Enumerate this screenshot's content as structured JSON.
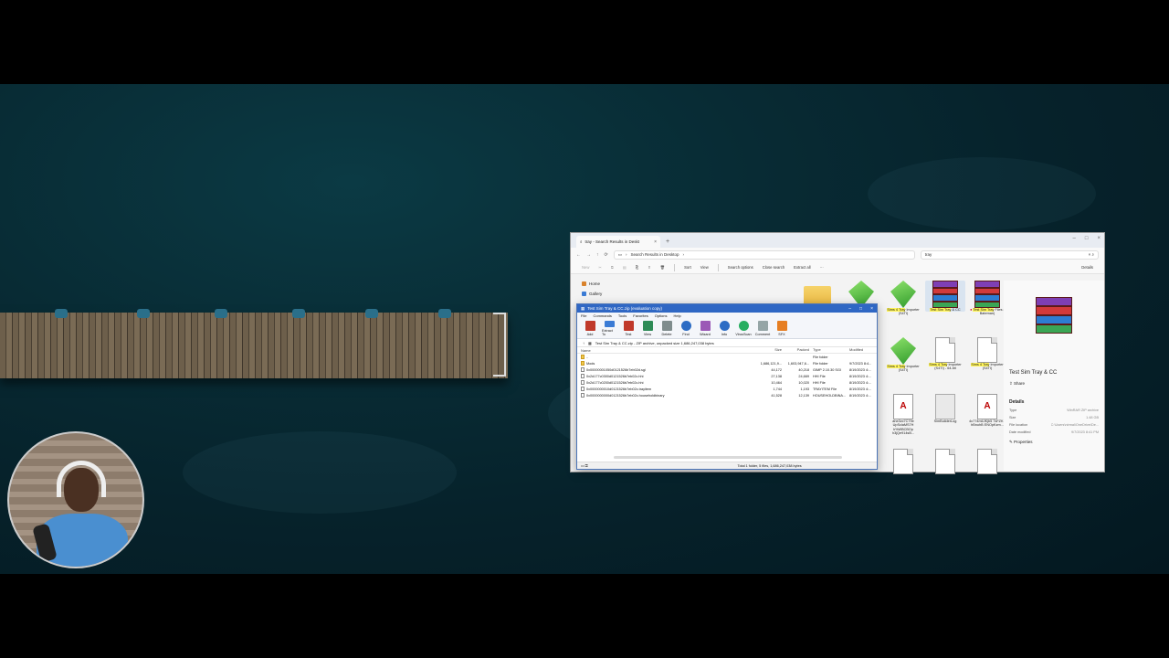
{
  "explorer": {
    "tab_title": "tray - Search Results in Deskt",
    "address": "Search Results in Desktop",
    "search_value": "tray",
    "cmd": {
      "new": "New",
      "sort": "Sort",
      "view": "View",
      "search_options": "Search options",
      "close_search": "Close search",
      "extract_all": "Extract all",
      "more": "···",
      "details": "Details"
    },
    "nav": [
      {
        "label": "Home"
      },
      {
        "label": "Gallery"
      }
    ],
    "tiles": [
      {
        "label": "",
        "kind": "folder"
      },
      {
        "label": "",
        "kind": "sims"
      },
      {
        "label": "Importer (S4TI)",
        "kind": "sims",
        "hl": "Sims 4 Tray"
      },
      {
        "label": "& CC",
        "kind": "rar",
        "hl": "Test Sim Tray",
        "selected": true
      },
      {
        "label": "Files ( Bateman)",
        "kind": "rar",
        "hl": "Test Sim Tray"
      },
      {
        "label": "Importer (S4TI)",
        "kind": "sims",
        "hl": "Sims 4 Tray"
      },
      {
        "label": "Importer (S4TI) - 64-bit",
        "kind": "doc",
        "hl": "Sims 4 Tray"
      },
      {
        "label": "Importer (S4TI)",
        "kind": "doc",
        "hl": "Sims 4 Tray"
      },
      {
        "label": "ahe3vc7C79e UpSclaMS7H h%WBCBOp h3jQe914sB...",
        "kind": "pdf"
      },
      {
        "label": "SimBuilderLog",
        "kind": "txt"
      },
      {
        "label": "4c774miLfKjb5 7sFZK - hBnuhB ENOpKzm...",
        "kind": "pdf"
      }
    ],
    "details": {
      "title": "Test Sim Tray & CC",
      "share": "Share",
      "heading": "Details",
      "rows": [
        {
          "k": "Type",
          "v": "WinRAR ZIP archive"
        },
        {
          "k": "Size",
          "v": "1.48 GB"
        },
        {
          "k": "File location",
          "v": "C:\\Users\\nirmal\\OneDrive\\De..."
        },
        {
          "k": "Date modified",
          "v": "9/7/2023 8:41 PM"
        }
      ],
      "properties": "Properties"
    }
  },
  "winrar": {
    "title": "Test Sim Tray & CC.zip (evaluation copy)",
    "menu": [
      "File",
      "Commands",
      "Tools",
      "Favorites",
      "Options",
      "Help"
    ],
    "toolbar": [
      {
        "label": "Add",
        "color": "#c0392b"
      },
      {
        "label": "Extract To",
        "color": "#3a7bd5"
      },
      {
        "label": "Test",
        "color": "#c0392b"
      },
      {
        "label": "View",
        "color": "#2e8b57"
      },
      {
        "label": "Delete",
        "color": "#7f8c8d"
      },
      {
        "label": "Find",
        "color": "#2c6cc4"
      },
      {
        "label": "Wizard",
        "color": "#9b59b6"
      },
      {
        "label": "Info",
        "color": "#2c6cc4"
      },
      {
        "label": "VirusScan",
        "color": "#27ae60"
      },
      {
        "label": "Comment",
        "color": "#95a5a6"
      },
      {
        "label": "SFX",
        "color": "#e67e22"
      }
    ],
    "path": "Test Sim Tray & CC.zip - ZIP archive, unpacked size 1,686,247,038 bytes",
    "columns": {
      "name": "Name",
      "size": "Size",
      "packed": "Packed",
      "type": "Type",
      "modified": "Modified"
    },
    "rows": [
      {
        "name": "..",
        "size": "",
        "packed": "",
        "type": "File folder",
        "modified": "",
        "folder": true
      },
      {
        "name": "Mods",
        "size": "1,686,121,9...",
        "packed": "1,603,947,6...",
        "type": "File folder",
        "modified": "9/7/2023 8:4...",
        "folder": true
      },
      {
        "name": "0x00000001050d0121526b7eb02d.sgi",
        "size": "44,172",
        "packed": "40,218",
        "type": "GIMP 2.10.30 SGI",
        "modified": "8/19/2023 4:..."
      },
      {
        "name": "0x2d177c0300d0121526b7eb02c.hhi",
        "size": "27,138",
        "packed": "24,669",
        "type": "HHI File",
        "modified": "8/19/2023 4:..."
      },
      {
        "name": "0x2d177c0200d0121526b7eb02c.hhi",
        "size": "10,464",
        "packed": "10,020",
        "type": "HHI File",
        "modified": "8/19/2023 4:..."
      },
      {
        "name": "0x0000000010d0121526b7eb02c.trayitem",
        "size": "1,744",
        "packed": "1,193",
        "type": "TRAYITEM File",
        "modified": "8/19/2023 4:..."
      },
      {
        "name": "0x0000000000d0121526b7eb02c.householdbinary",
        "size": "41,528",
        "packed": "12,139",
        "type": "HOUSEHOLDBINA...",
        "modified": "8/19/2023 4:..."
      }
    ],
    "status_total": "Total 1 folder, 5 files, 1,686,247,038 bytes"
  }
}
